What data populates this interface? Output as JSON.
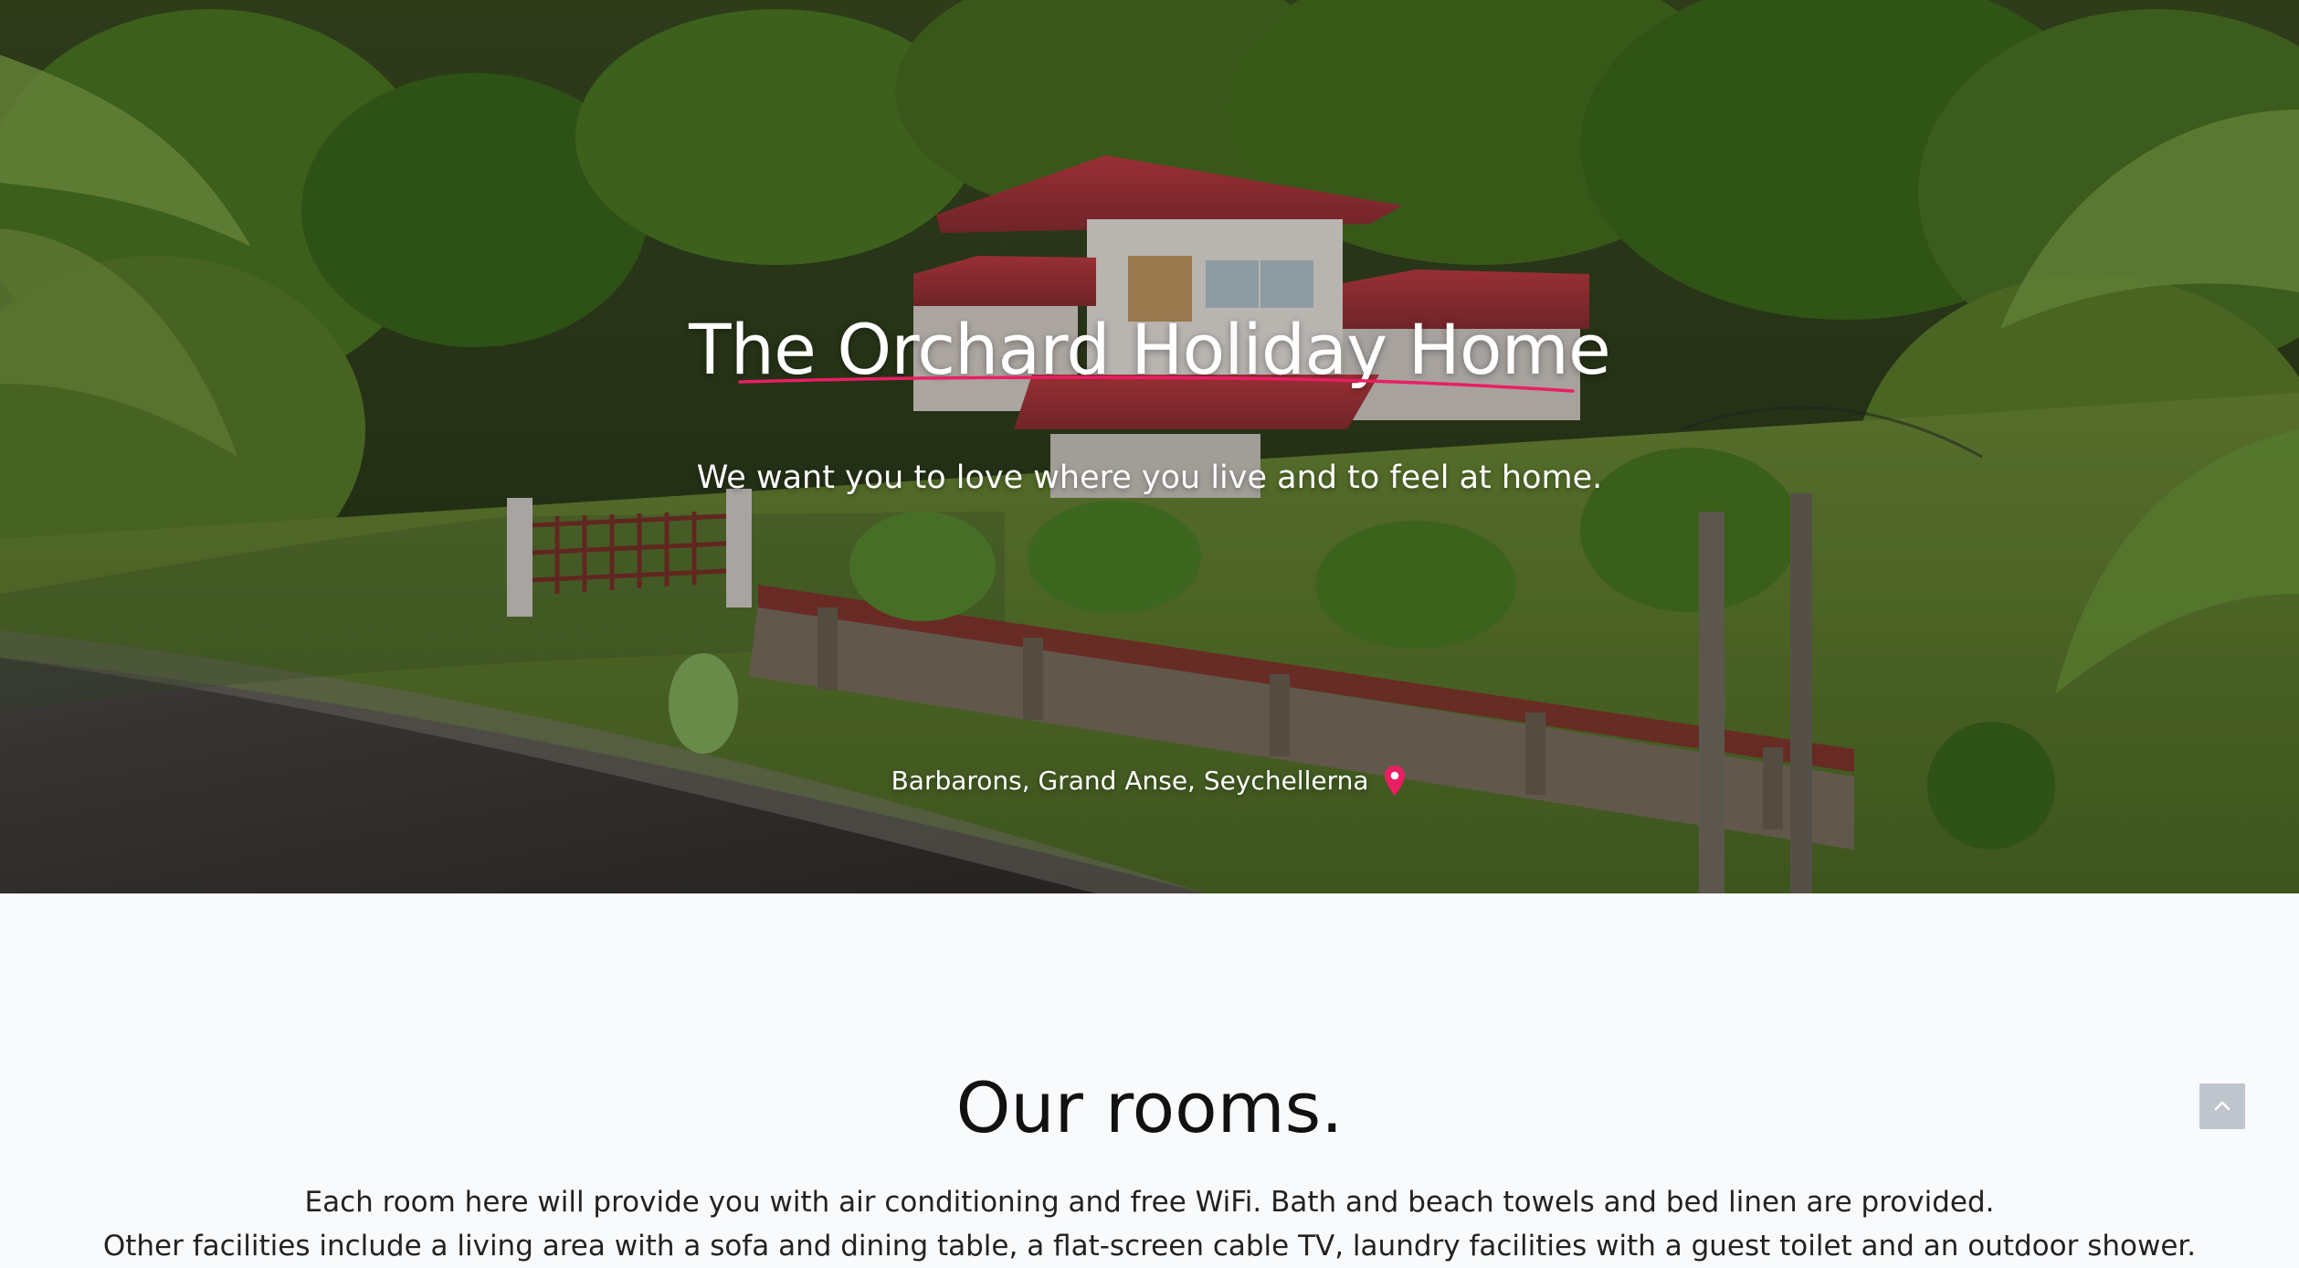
{
  "hero": {
    "title": "The Orchard Holiday Home",
    "subtitle": "We want you to love where you live and to feel at home.",
    "location": "Barbarons, Grand Anse, Seychellerna",
    "location_icon": "map-pin-icon",
    "accent_color": "#e91e63"
  },
  "rooms": {
    "title": "Our rooms.",
    "description_lines": [
      "Each room here will provide you with air conditioning and free WiFi. Bath and beach towels and bed linen are provided.",
      "Other facilities include a living area with a sofa and dining table, a flat-screen cable TV, laundry facilities with a guest toilet and an outdoor shower."
    ]
  },
  "controls": {
    "scroll_top_icon": "chevron-up-icon"
  }
}
